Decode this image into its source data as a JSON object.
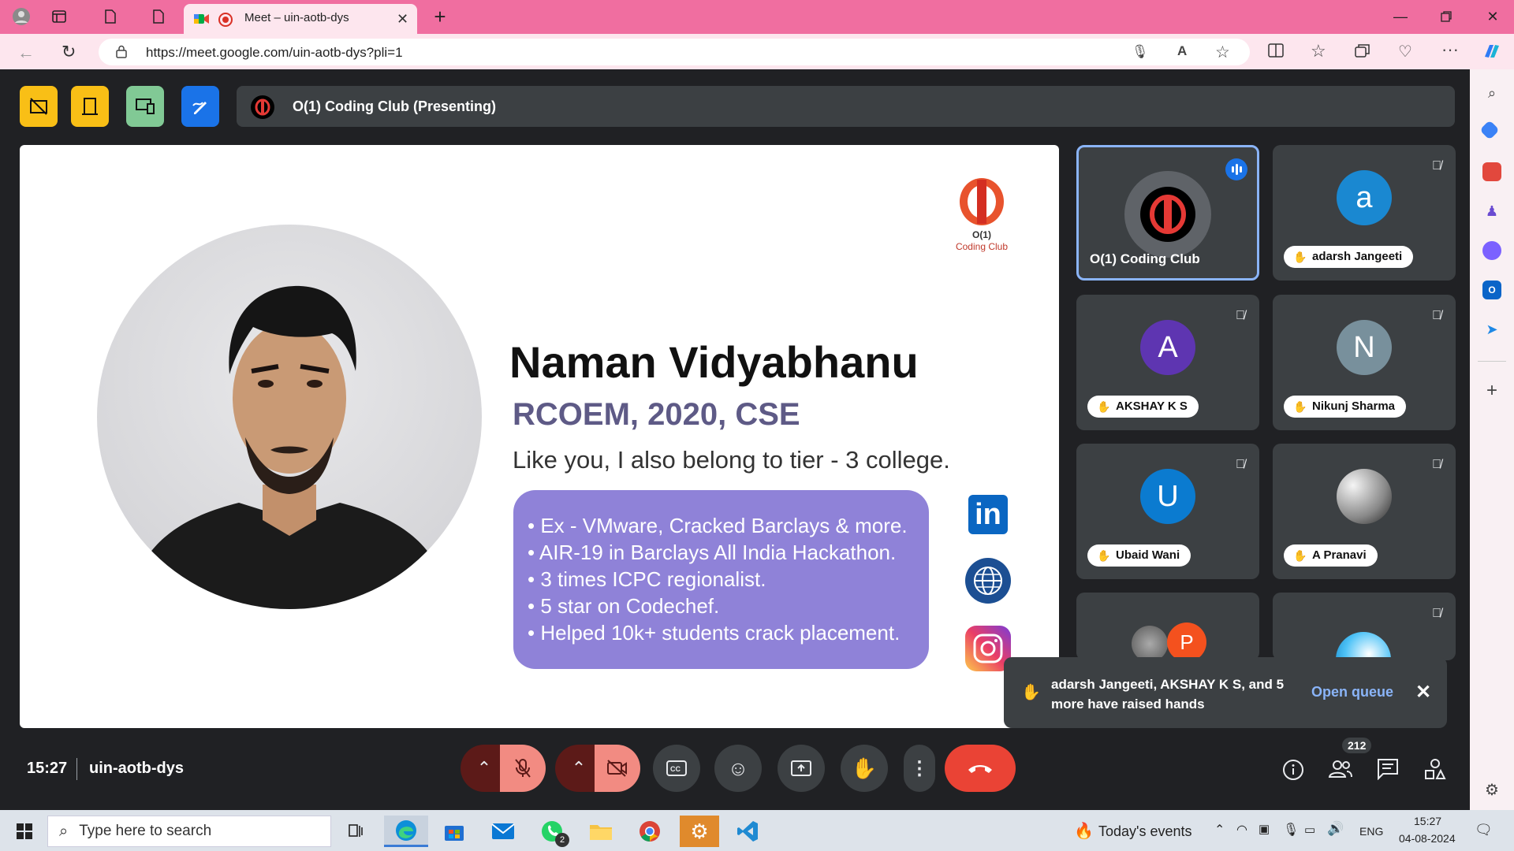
{
  "browser": {
    "tab_title": "Meet – uin-aotb-dys",
    "url": "https://meet.google.com/uin-aotb-dys?pli=1"
  },
  "meet": {
    "presenting_label": "O(1) Coding Club (Presenting)",
    "time": "15:27",
    "meeting_code": "uin-aotb-dys",
    "participant_count": "212"
  },
  "slide": {
    "logo_top": "O(1)",
    "logo_bottom": "Coding Club",
    "speaker_name": "Naman Vidyabhanu",
    "education": "RCOEM, 2020, CSE",
    "tagline": "Like you, I also belong to tier - 3 college.",
    "bullets": [
      "• Ex - VMware, Cracked Barclays & more.",
      "• AIR-19 in Barclays All India Hackathon.",
      "• 3 times ICPC regionalist.",
      "• 5 star on Codechef.",
      "• Helped 10k+ students crack placement."
    ],
    "linkedin": "in"
  },
  "participants": [
    {
      "name": "O(1) Coding Club",
      "initial": "",
      "color": "#000000"
    },
    {
      "name": "adarsh Jangeeti",
      "initial": "a",
      "color": "#1a88d1"
    },
    {
      "name": "AKSHAY K S",
      "initial": "A",
      "color": "#5e35b1"
    },
    {
      "name": "Nikunj Sharma",
      "initial": "N",
      "color": "#78909c"
    },
    {
      "name": "Ubaid Wani",
      "initial": "U",
      "color": "#0b7bd0"
    },
    {
      "name": "A Pranavi",
      "initial": "",
      "color": "#cccccc"
    },
    {
      "name": "",
      "initial": "P",
      "color": "#f4511e"
    },
    {
      "name": "",
      "initial": "",
      "color": "#4fc3f7"
    }
  ],
  "toast": {
    "message": "adarsh Jangeeti, AKSHAY K S, and 5 more have raised hands",
    "action": "Open queue"
  },
  "taskbar": {
    "search_placeholder": "Type here to search",
    "events": "Today's events",
    "lang": "ENG",
    "clock_time": "15:27",
    "clock_date": "04-08-2024",
    "whatsapp_badge": "2"
  }
}
